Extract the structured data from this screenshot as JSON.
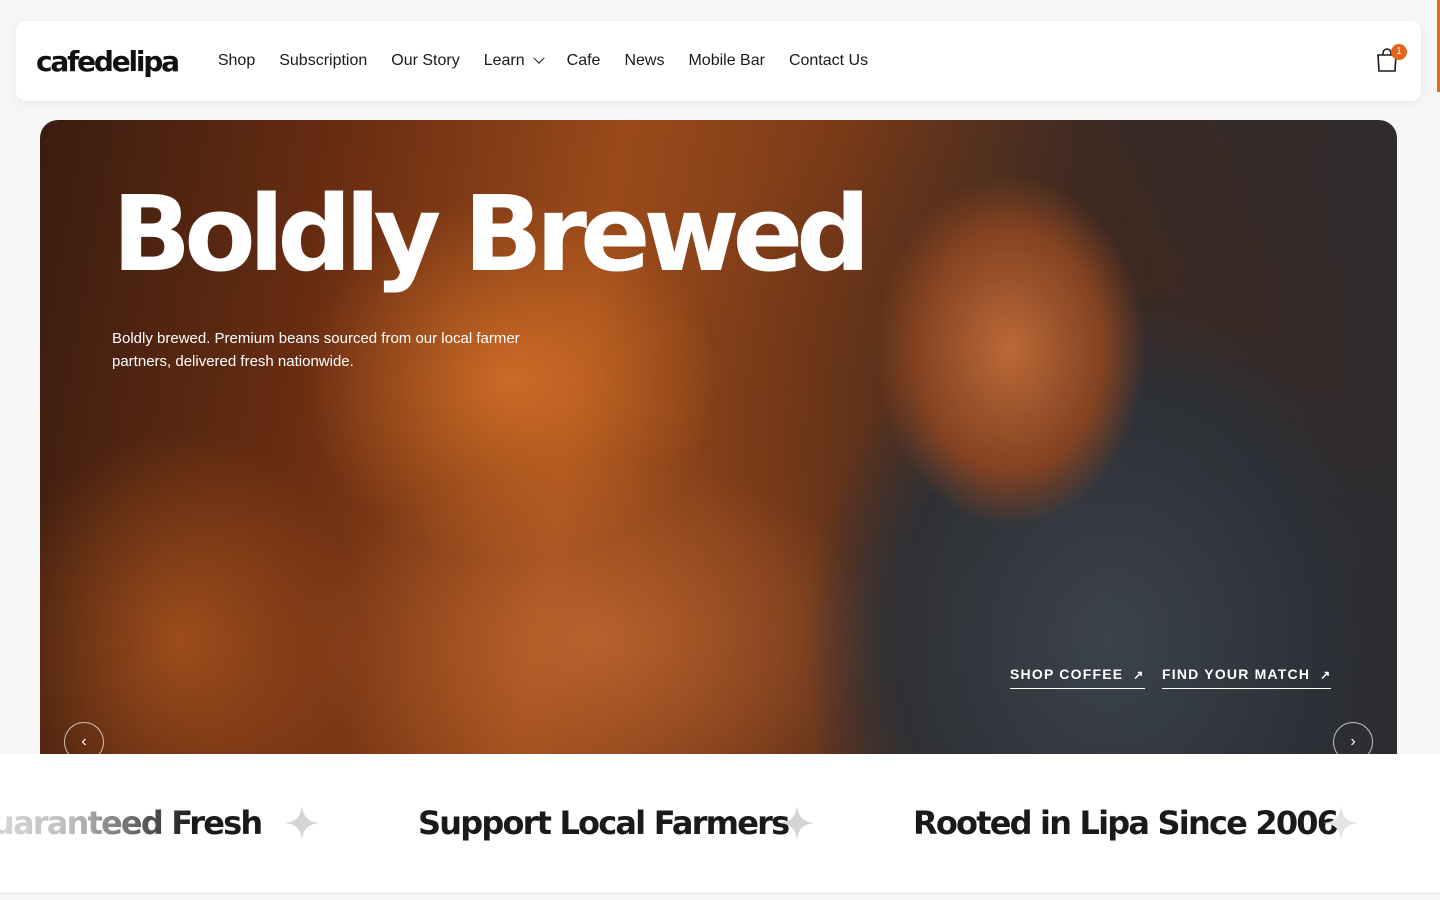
{
  "header": {
    "logo": "cafedelipa",
    "nav": [
      "Shop",
      "Subscription",
      "Our Story",
      "Learn",
      "Cafe",
      "News",
      "Mobile Bar",
      "Contact Us"
    ],
    "cart_count": "1"
  },
  "hero": {
    "title": "Boldly Brewed",
    "subtitle": "Boldly brewed. Premium beans sourced from our local farmer partners, delivered fresh nationwide.",
    "cta_primary": "SHOP COFFEE",
    "cta_secondary": "FIND YOUR MATCH",
    "arrow": "↗",
    "prev": "‹",
    "next": "›"
  },
  "marquee": {
    "items": [
      "uaranteed Fresh",
      "Support Local Farmers",
      "Rooted in Lipa Since 2006"
    ],
    "separator_icon": "four-point-star-icon"
  },
  "colors": {
    "accent": "#e8621a",
    "text_dark": "#1a1a1a",
    "star": "#d4d4d4"
  }
}
